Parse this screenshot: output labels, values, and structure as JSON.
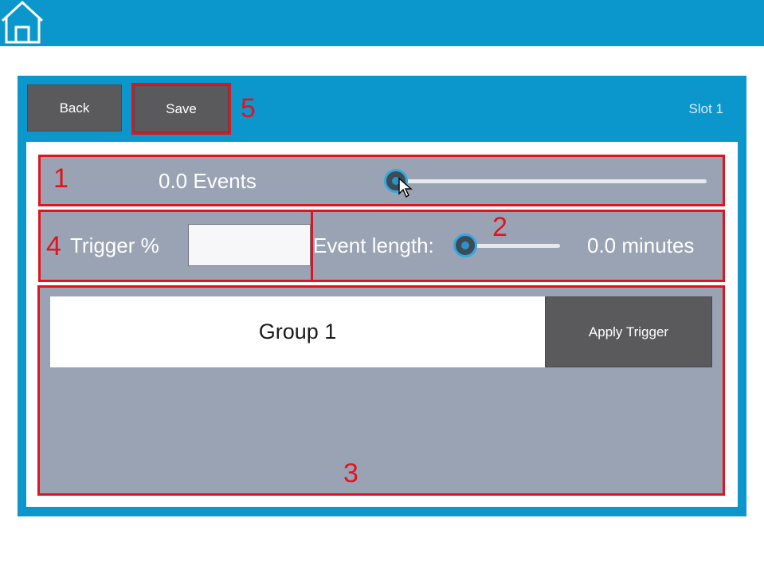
{
  "header": {
    "home_icon": "home-icon"
  },
  "toolbar": {
    "back_label": "Back",
    "save_label": "Save",
    "slot_label": "Slot 1"
  },
  "events": {
    "label": "0.0 Events",
    "slider_fraction": 0
  },
  "trigger": {
    "label": "Trigger %",
    "value": "",
    "placeholder": ""
  },
  "event_length": {
    "label": "Event length:",
    "value_text": "0.0 minutes",
    "slider_fraction": 0
  },
  "groups": [
    {
      "name": "Group 1",
      "action_label": "Apply Trigger"
    }
  ],
  "annotations": [
    "1",
    "2",
    "3",
    "4",
    "5"
  ],
  "colors": {
    "header": "#0b97cc",
    "panel_row": "#9aa3b4",
    "button_dark": "#5a5a5c",
    "annotation": "#e0141e"
  }
}
